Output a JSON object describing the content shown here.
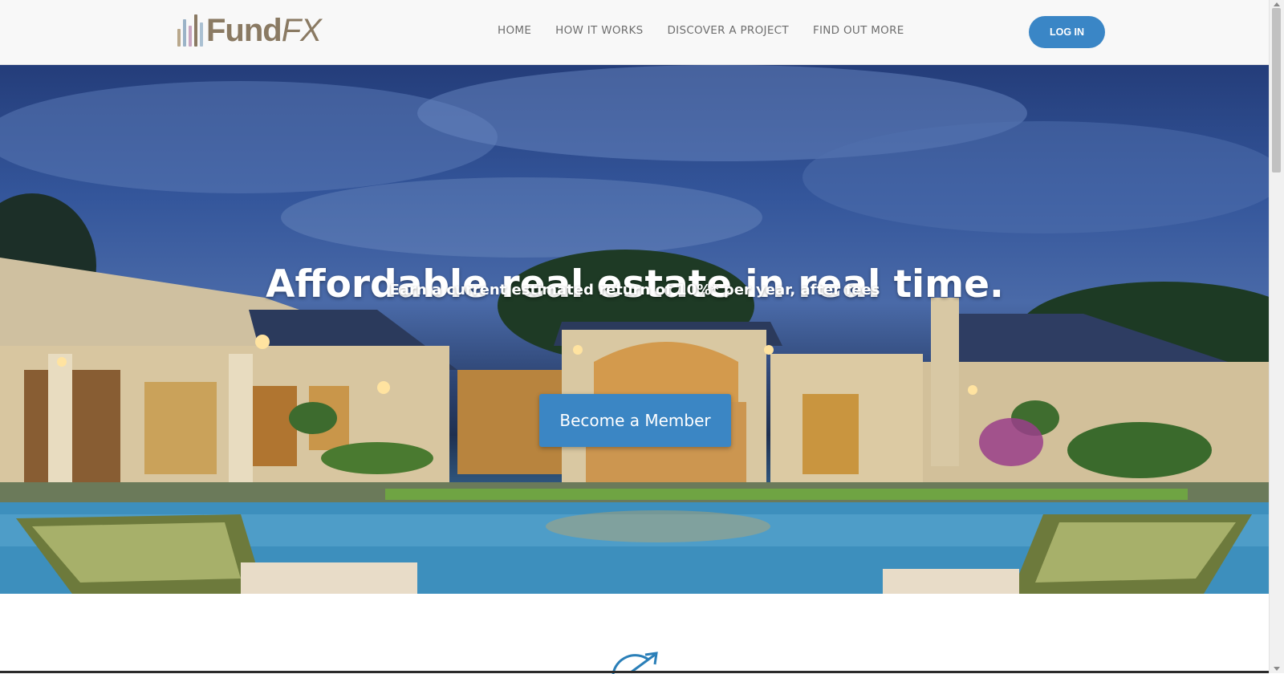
{
  "brand": {
    "name_plain": "Fund",
    "name_italic": "FX",
    "bar_colors": [
      "#b9a88c",
      "#9bb3c7",
      "#c9a6c1",
      "#8a7a63",
      "#aac0d2"
    ]
  },
  "nav": {
    "items": [
      "HOME",
      "HOW IT WORKS",
      "DISCOVER A PROJECT",
      "FIND OUT MORE"
    ]
  },
  "login": {
    "label": "LOG IN"
  },
  "hero": {
    "title": "Affordable real estate in real time.",
    "subtitle": "Earn a current estimated return of 10%* per year, after fees",
    "cta_label": "Become a Member"
  },
  "colors": {
    "accent": "#3a86c6",
    "cta": "#3b86c4",
    "icon": "#2a7fb8"
  }
}
